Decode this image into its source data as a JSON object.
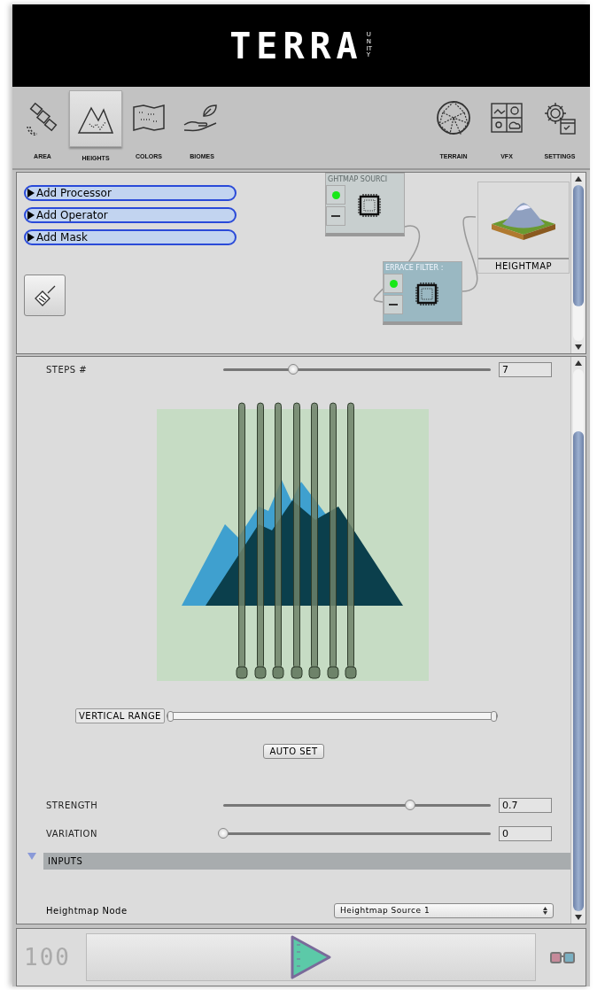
{
  "logo": {
    "title": "TERRA",
    "subtitle": "UNITY"
  },
  "tabs_left": [
    {
      "label": "AREA",
      "selected": false
    },
    {
      "label": "HEIGHTS",
      "selected": true
    },
    {
      "label": "COLORS",
      "selected": false
    },
    {
      "label": "BIOMES",
      "selected": false
    }
  ],
  "tabs_right": [
    {
      "label": "TERRAIN"
    },
    {
      "label": "VFX"
    },
    {
      "label": "SETTINGS"
    }
  ],
  "node_panel": {
    "menu_buttons": [
      "Add Processor",
      "Add Operator",
      "Add Mask"
    ],
    "nodes": [
      {
        "title": "GHTMAP SOURCI",
        "selected": false,
        "enabled": true
      },
      {
        "title": "ERRACE FILTER :",
        "selected": true,
        "enabled": true
      }
    ],
    "output": {
      "label": "HEIGHTMAP"
    }
  },
  "inspector": {
    "steps": {
      "label": "STEPS #",
      "level": 0.26,
      "value": "7"
    },
    "vertical_range": {
      "label": "VERTICAL RANGE",
      "level": 1
    },
    "auto_set": "AUTO SET",
    "sliders": [
      {
        "label": "STRENGTH",
        "level": 0.7,
        "value": "0.7"
      },
      {
        "label": "VARIATION",
        "level": 0,
        "value": "0"
      }
    ],
    "section": {
      "label": "INPUTS",
      "expanded": true
    },
    "field": {
      "label": "Heightmap Node",
      "value": "Heightmap Source 1"
    }
  },
  "bottom_bar": {
    "counter": "100"
  }
}
